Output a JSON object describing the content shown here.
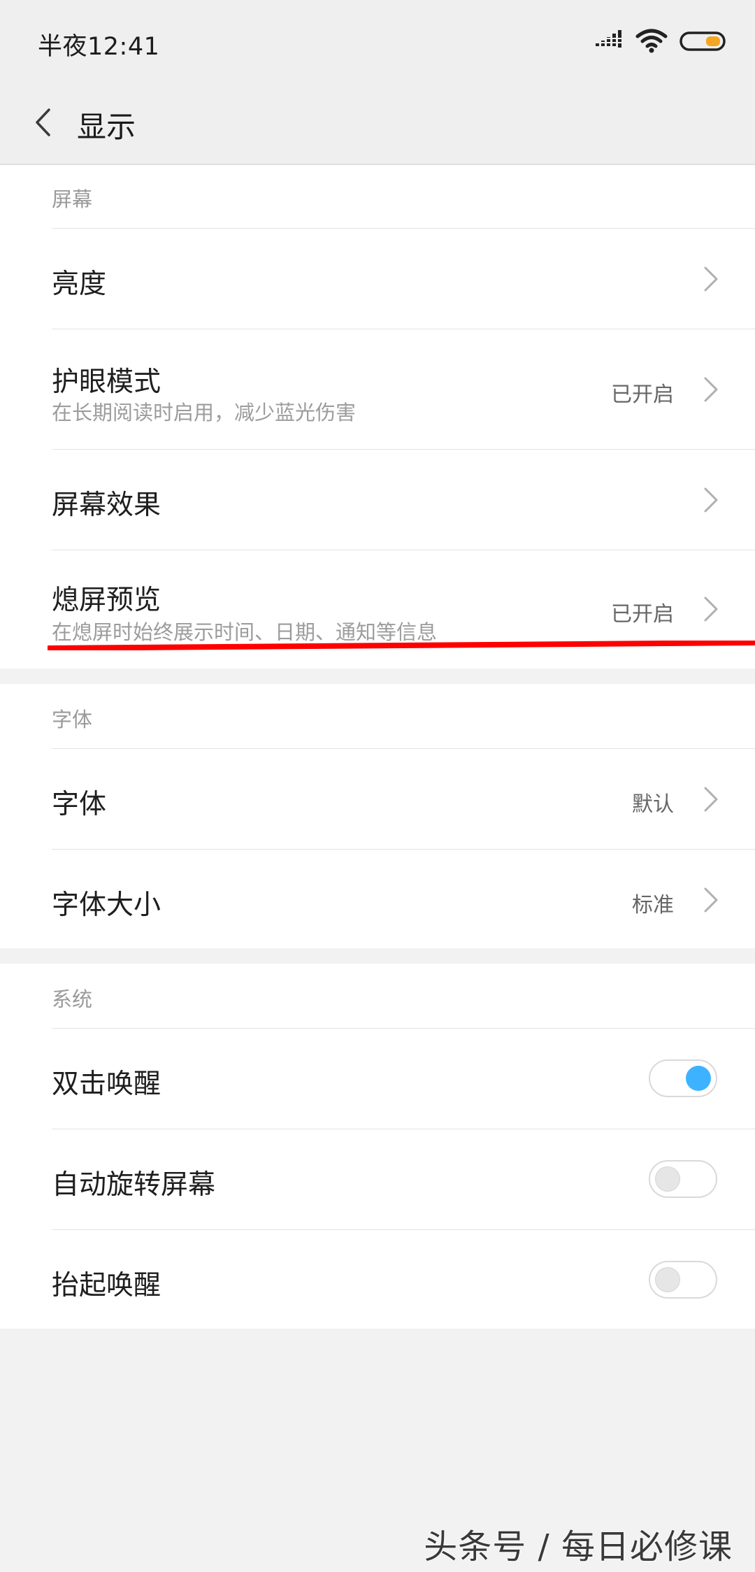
{
  "status_bar": {
    "time": "半夜12:41"
  },
  "header": {
    "title": "显示"
  },
  "sections": [
    {
      "title": "屏幕",
      "items": [
        {
          "label": "亮度",
          "subtitle": "",
          "value": ""
        },
        {
          "label": "护眼模式",
          "subtitle": "在长期阅读时启用，减少蓝光伤害",
          "value": "已开启"
        },
        {
          "label": "屏幕效果",
          "subtitle": "",
          "value": ""
        },
        {
          "label": "熄屏预览",
          "subtitle": "在熄屏时始终展示时间、日期、通知等信息",
          "value": "已开启"
        }
      ]
    },
    {
      "title": "字体",
      "items": [
        {
          "label": "字体",
          "value": "默认"
        },
        {
          "label": "字体大小",
          "value": "标准"
        }
      ]
    },
    {
      "title": "系统",
      "items": [
        {
          "label": "双击唤醒",
          "enabled": true
        },
        {
          "label": "自动旋转屏幕",
          "enabled": false
        },
        {
          "label": "抬起唤醒",
          "enabled": false
        }
      ]
    }
  ],
  "watermark": "头条号 / 每日必修课",
  "colors": {
    "accent": "#3db3ff",
    "battery": "#f5a623",
    "annotation": "#ff0000"
  }
}
